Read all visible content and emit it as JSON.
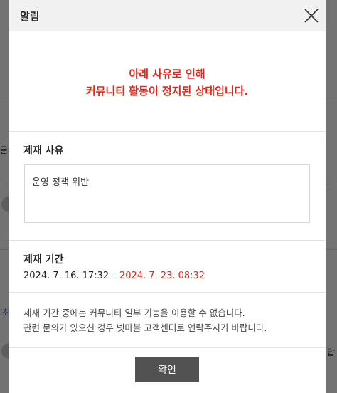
{
  "background": {
    "snippets": [
      "글",
      "초",
      "답"
    ]
  },
  "modal": {
    "title": "알림",
    "notice_line1": "아래 사유로 인해",
    "notice_line2": "커뮤니티 활동이 정지된 상태입니다.",
    "reason_label": "제재 사유",
    "reason_text": "운영 정책 위반",
    "period_label": "제재 기간",
    "period_start": "2024. 7. 16. 17:32 – ",
    "period_end": "2024. 7. 23. 08:32",
    "info_line1": "제재 기간 중에는 커뮤니티 일부 기능을 이용할 수 없습니다.",
    "info_line2": "관련 문의가 있으신 경우 넷마블 고객센터로 연락주시기 바랍니다.",
    "ok_label": "확인",
    "close_icon": "close-icon"
  },
  "colors": {
    "accent_red": "#e5261e",
    "button_bg": "#525252",
    "header_bg": "#f1f1f1"
  }
}
